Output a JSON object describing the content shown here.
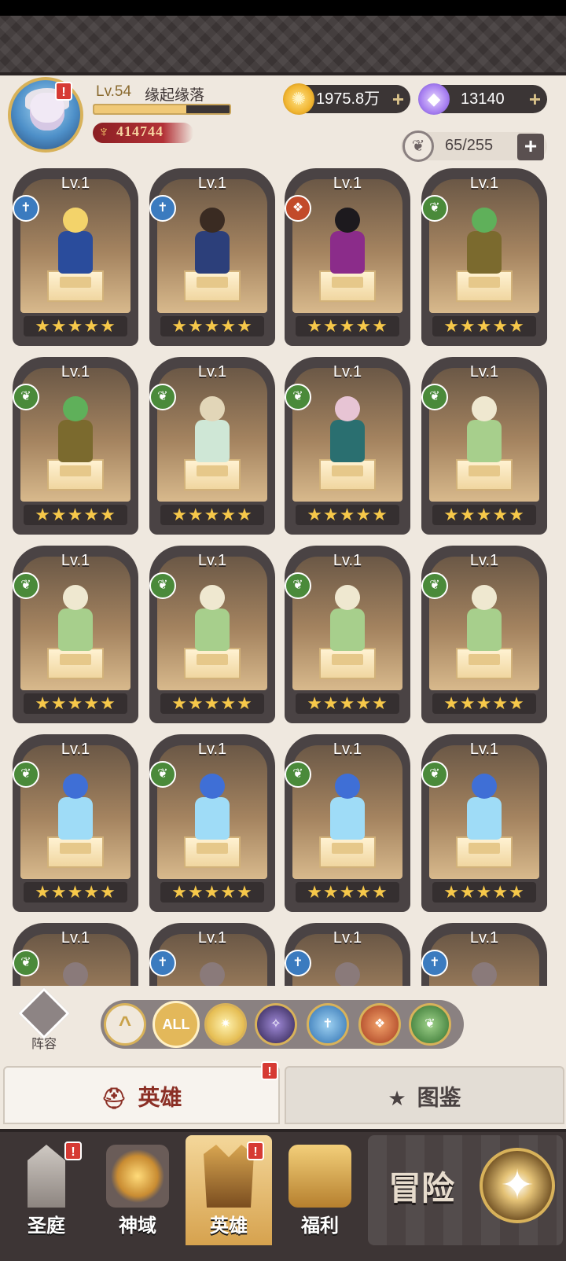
{
  "player": {
    "level_label": "Lv.54",
    "name": "缘起缘落",
    "xp_progress": 0.68,
    "power": "414744",
    "alert": "!"
  },
  "currencies": {
    "gold": "1975.8万",
    "gems": "13140",
    "plus": "+"
  },
  "hero_capacity": {
    "count": "65/255",
    "plus": "+"
  },
  "heroes": [
    {
      "level": "Lv.1",
      "stars": "★★★★★",
      "faction": "light-icon",
      "hair": "#f3d36a",
      "outfit": "#2a4c9c"
    },
    {
      "level": "Lv.1",
      "stars": "★★★★★",
      "faction": "light-icon",
      "hair": "#3a2b22",
      "outfit": "#2c3f7a"
    },
    {
      "level": "Lv.1",
      "stars": "★★★★★",
      "faction": "beast-icon",
      "hair": "#1d1a1e",
      "outfit": "#8b2c8a"
    },
    {
      "level": "Lv.1",
      "stars": "★★★★★",
      "faction": "nature-icon",
      "hair": "#5fb05a",
      "outfit": "#7b6a2e"
    },
    {
      "level": "Lv.1",
      "stars": "★★★★★",
      "faction": "nature-icon",
      "hair": "#5fb05a",
      "outfit": "#7b6a2e"
    },
    {
      "level": "Lv.1",
      "stars": "★★★★★",
      "faction": "nature-icon",
      "hair": "#e2d6b8",
      "outfit": "#cfe7d6"
    },
    {
      "level": "Lv.1",
      "stars": "★★★★★",
      "faction": "nature-icon",
      "hair": "#e7c4d4",
      "outfit": "#2a6f70"
    },
    {
      "level": "Lv.1",
      "stars": "★★★★★",
      "faction": "nature-icon",
      "hair": "#efe8d0",
      "outfit": "#a7cf8c"
    },
    {
      "level": "Lv.1",
      "stars": "★★★★★",
      "faction": "nature-icon",
      "hair": "#efe8d0",
      "outfit": "#a7cf8c"
    },
    {
      "level": "Lv.1",
      "stars": "★★★★★",
      "faction": "nature-icon",
      "hair": "#efe8d0",
      "outfit": "#a7cf8c"
    },
    {
      "level": "Lv.1",
      "stars": "★★★★★",
      "faction": "nature-icon",
      "hair": "#efe8d0",
      "outfit": "#a7cf8c"
    },
    {
      "level": "Lv.1",
      "stars": "★★★★★",
      "faction": "nature-icon",
      "hair": "#efe8d0",
      "outfit": "#a7cf8c"
    },
    {
      "level": "Lv.1",
      "stars": "★★★★★",
      "faction": "nature-icon",
      "hair": "#3f6fd6",
      "outfit": "#9fdcf7"
    },
    {
      "level": "Lv.1",
      "stars": "★★★★★",
      "faction": "nature-icon",
      "hair": "#3f6fd6",
      "outfit": "#9fdcf7"
    },
    {
      "level": "Lv.1",
      "stars": "★★★★★",
      "faction": "nature-icon",
      "hair": "#3f6fd6",
      "outfit": "#9fdcf7"
    },
    {
      "level": "Lv.1",
      "stars": "★★★★★",
      "faction": "nature-icon",
      "hair": "#3f6fd6",
      "outfit": "#9fdcf7"
    },
    {
      "level": "Lv.1",
      "stars": "★★★★★",
      "faction": "nature-icon",
      "hair": "#8a7a7a",
      "outfit": "#6a5a5a"
    },
    {
      "level": "Lv.1",
      "stars": "★★★★★",
      "faction": "light-icon",
      "hair": "#8a7a7a",
      "outfit": "#6a5a5a"
    },
    {
      "level": "Lv.1",
      "stars": "★★★★★",
      "faction": "light-icon",
      "hair": "#8a7a7a",
      "outfit": "#6a5a5a"
    },
    {
      "level": "Lv.1",
      "stars": "★★★★★",
      "faction": "light-icon",
      "hair": "#8a7a7a",
      "outfit": "#6a5a5a"
    }
  ],
  "lineup": {
    "label": "阵容"
  },
  "filters": {
    "collapse": "^",
    "all": "ALL",
    "items": [
      "holy-icon",
      "dark-icon",
      "light-icon",
      "beast-icon",
      "nature-icon"
    ]
  },
  "tabs": {
    "heroes": "英雄",
    "codex": "图鉴"
  },
  "nav": {
    "court": "圣庭",
    "realm": "神域",
    "heroes": "英雄",
    "welfare": "福利",
    "adventure": "冒险"
  }
}
